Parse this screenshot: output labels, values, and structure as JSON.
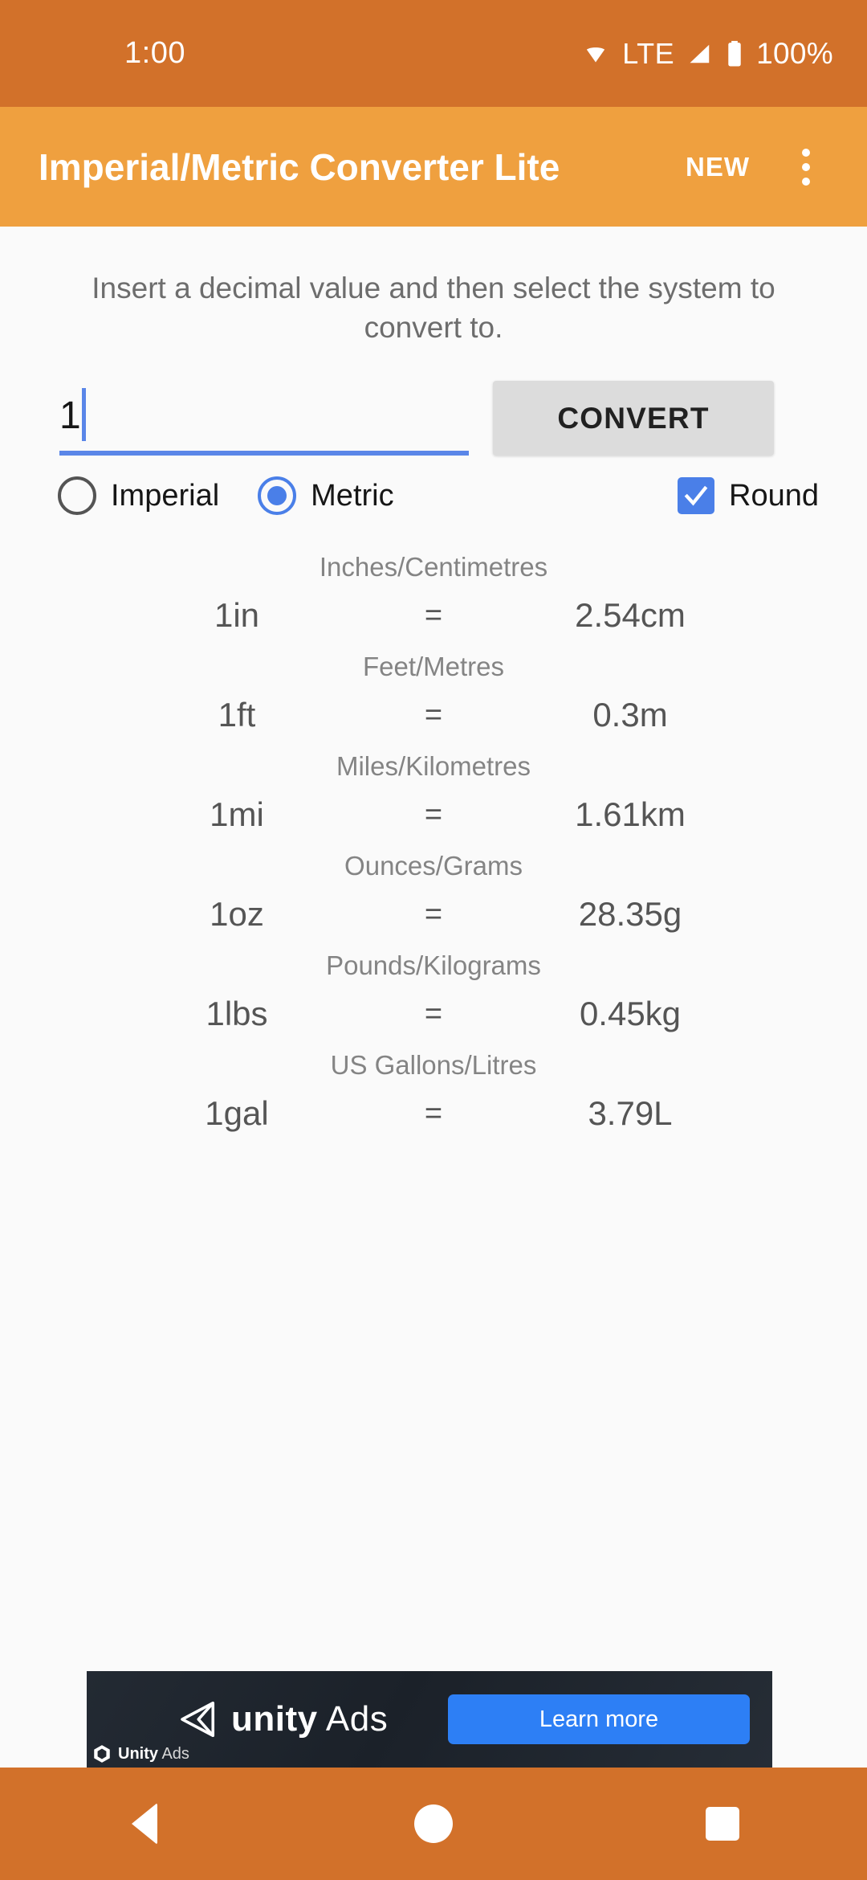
{
  "status_bar": {
    "time": "1:00",
    "network_type": "LTE",
    "battery_percent": "100%",
    "background_color": "#d2712a",
    "icons": [
      "wifi-icon",
      "signal-icon",
      "battery-icon"
    ]
  },
  "app_bar": {
    "title": "Imperial/Metric Converter Lite",
    "action_new": "NEW",
    "overflow_menu": "more-options",
    "background_color": "#efa03f"
  },
  "main": {
    "instructions": "Insert a decimal value and then select the system to convert to.",
    "input": {
      "value": "1",
      "placeholder": "",
      "underline_color": "#5a86e8"
    },
    "convert_button": "CONVERT",
    "system_options": [
      {
        "label": "Imperial",
        "selected": false
      },
      {
        "label": "Metric",
        "selected": true
      }
    ],
    "round_option": {
      "label": "Round",
      "checked": true
    },
    "accent_color": "#4a7fe8"
  },
  "results": [
    {
      "title": "Inches/Centimetres",
      "left": "1in",
      "equals": "=",
      "right": "2.54cm"
    },
    {
      "title": "Feet/Metres",
      "left": "1ft",
      "equals": "=",
      "right": "0.3m"
    },
    {
      "title": "Miles/Kilometres",
      "left": "1mi",
      "equals": "=",
      "right": "1.61km"
    },
    {
      "title": "Ounces/Grams",
      "left": "1oz",
      "equals": "=",
      "right": "28.35g"
    },
    {
      "title": "Pounds/Kilograms",
      "left": "1lbs",
      "equals": "=",
      "right": "0.45kg"
    },
    {
      "title": "US Gallons/Litres",
      "left": "1gal",
      "equals": "=",
      "right": "3.79L"
    }
  ],
  "ad": {
    "brand_bold": "unity",
    "brand_light": " Ads",
    "cta": "Learn more",
    "badge_bold": "Unity",
    "badge_light": "Ads",
    "cta_color": "#2d7ff5"
  },
  "nav_bar": {
    "back": "back-button",
    "home": "home-button",
    "recents": "recents-button",
    "background_color": "#d2712a"
  }
}
